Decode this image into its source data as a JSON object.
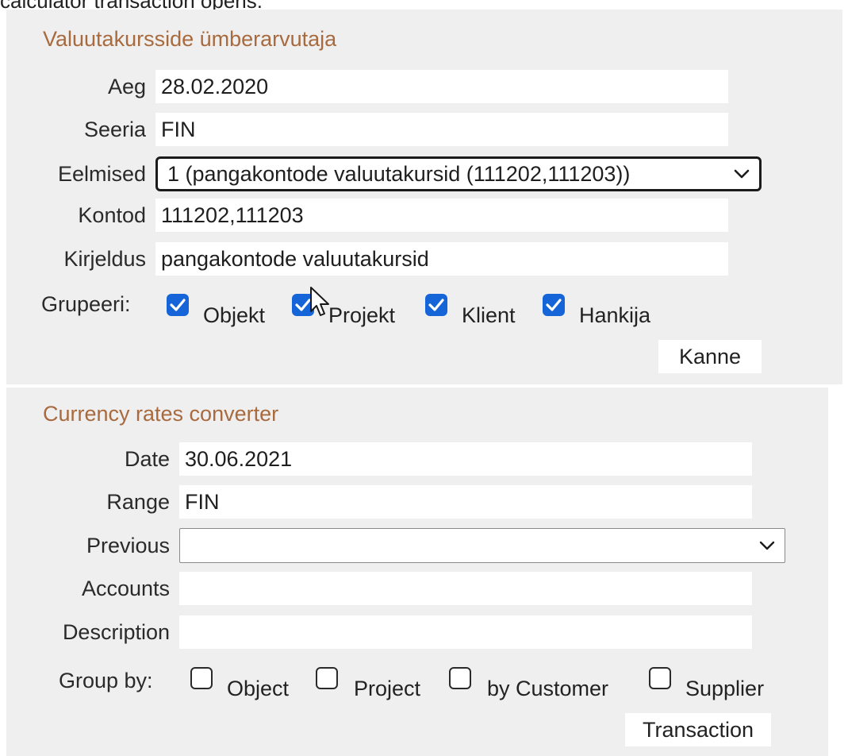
{
  "caption": "calculator transaction opens.",
  "estonian_form": {
    "title": "Valuutakursside ümberarvutaja",
    "fields": {
      "aeg": {
        "label": "Aeg",
        "value": "28.02.2020"
      },
      "seeria": {
        "label": "Seeria",
        "value": "FIN"
      },
      "eelmised": {
        "label": "Eelmised",
        "value": "1 (pangakontode valuutakursid (111202,111203))"
      },
      "kontod": {
        "label": "Kontod",
        "value": "111202,111203"
      },
      "kirjeldus": {
        "label": "Kirjeldus",
        "value": "pangakontode valuutakursid"
      }
    },
    "group": {
      "label": "Grupeeri:",
      "options": [
        {
          "label": "Objekt",
          "checked": true
        },
        {
          "label": "Projekt",
          "checked": true
        },
        {
          "label": "Klient",
          "checked": true
        },
        {
          "label": "Hankija",
          "checked": true
        }
      ]
    },
    "button_label": "Kanne"
  },
  "english_form": {
    "title": "Currency rates converter",
    "fields": {
      "date": {
        "label": "Date",
        "value": "30.06.2021"
      },
      "range": {
        "label": "Range",
        "value": "FIN"
      },
      "previous": {
        "label": "Previous",
        "value": ""
      },
      "accounts": {
        "label": "Accounts",
        "value": ""
      },
      "description": {
        "label": "Description",
        "value": ""
      }
    },
    "group": {
      "label": "Group by:",
      "options": [
        {
          "label": "Object",
          "checked": false
        },
        {
          "label": "Project",
          "checked": false
        },
        {
          "label": "by Customer",
          "checked": false
        },
        {
          "label": "Supplier",
          "checked": false
        }
      ]
    },
    "button_label": "Transaction"
  },
  "colors": {
    "title": "#a86a3e",
    "panel_background": "#efefef",
    "checkbox_checked": "#1565d8"
  },
  "icons": {
    "chevron": "chevron-down-icon",
    "checkmark": "checkmark-icon",
    "cursor": "mouse-pointer-icon"
  }
}
